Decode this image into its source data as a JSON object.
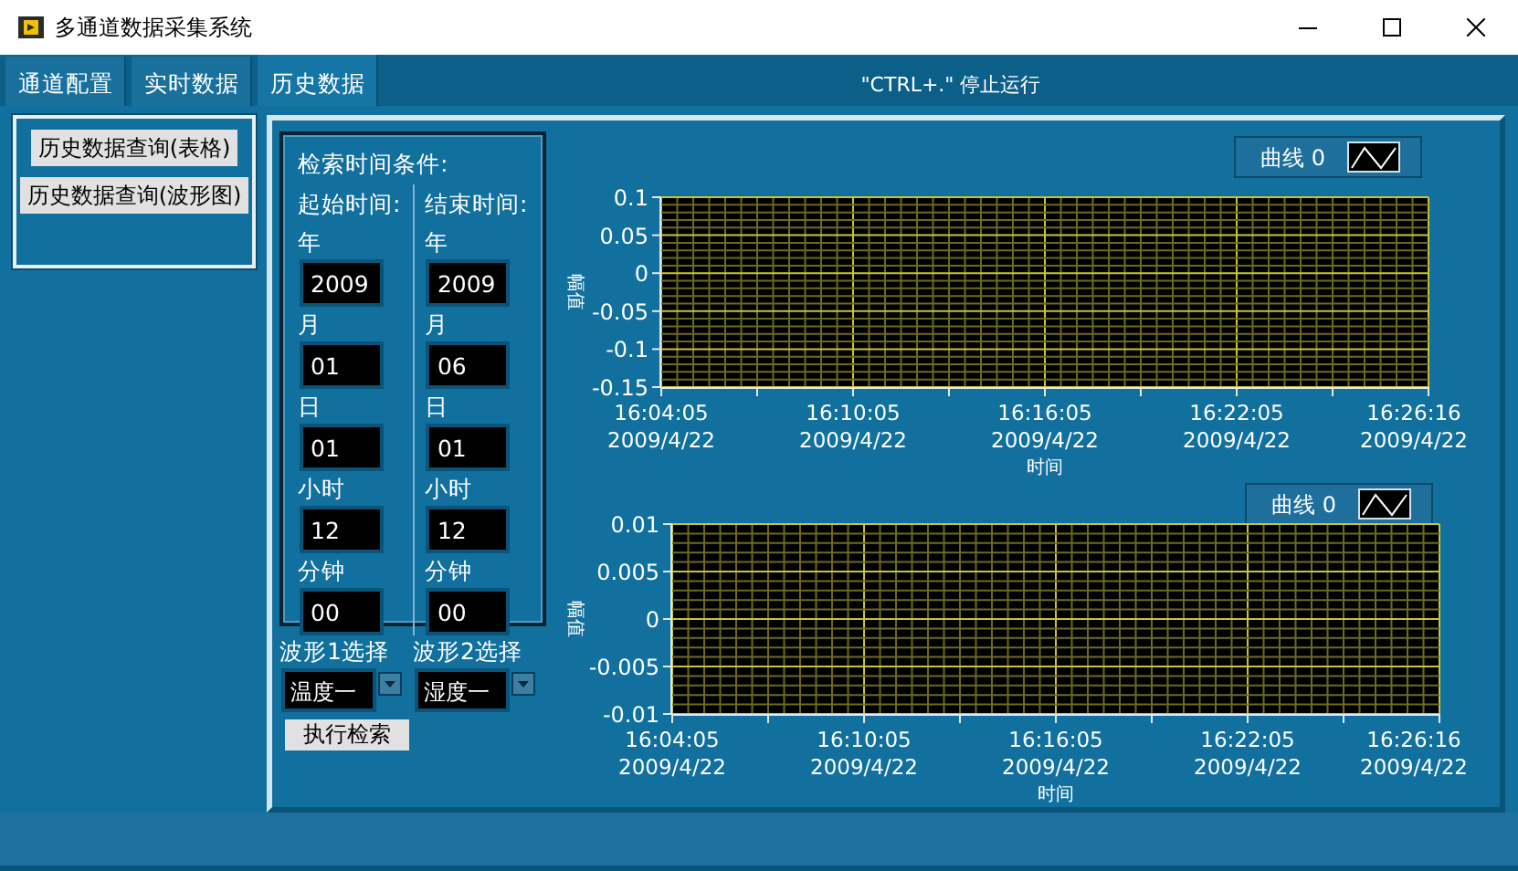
{
  "window": {
    "title": "多通道数据采集系统"
  },
  "tabs": [
    {
      "label": "通道配置",
      "selected": false
    },
    {
      "label": "实时数据",
      "selected": false
    },
    {
      "label": "历史数据",
      "selected": true
    }
  ],
  "status_hint": "\"CTRL+.\" 停止运行",
  "query_buttons": [
    "历史数据查询(表格)",
    "历史数据查询(波形图)"
  ],
  "time_conditions": {
    "title": "检索时间条件:",
    "columns": [
      {
        "heading": "起始时间:",
        "fields": [
          {
            "label": "年",
            "value": "2009"
          },
          {
            "label": "月",
            "value": "01"
          },
          {
            "label": "日",
            "value": "01"
          },
          {
            "label": "小时",
            "value": "12"
          },
          {
            "label": "分钟",
            "value": "00"
          }
        ]
      },
      {
        "heading": "结束时间:",
        "fields": [
          {
            "label": "年",
            "value": "2009"
          },
          {
            "label": "月",
            "value": "06"
          },
          {
            "label": "日",
            "value": "01"
          },
          {
            "label": "小时",
            "value": "12"
          },
          {
            "label": "分钟",
            "value": "00"
          }
        ]
      }
    ]
  },
  "waveform_selectors": [
    {
      "label": "波形1选择",
      "value": "温度一"
    },
    {
      "label": "波形2选择",
      "value": "湿度一"
    }
  ],
  "search_button": "执行检索",
  "charts": [
    {
      "chart_data": {
        "type": "line",
        "xlabel": "时间",
        "ylabel": "幅值",
        "ylim": [
          -0.15,
          0.1
        ],
        "yticks": [
          0.1,
          0.05,
          0,
          -0.05,
          -0.1,
          -0.15
        ],
        "categories": [
          "16:04:05 2009/4/22",
          "16:10:05 2009/4/22",
          "16:16:05 2009/4/22",
          "16:22:05 2009/4/22",
          "16:26:16 2009/4/22"
        ],
        "grid": true,
        "series": [
          {
            "name": "曲线 0",
            "color": "#ffffff",
            "values": [
              null,
              null,
              null,
              null,
              null
            ]
          }
        ]
      }
    },
    {
      "chart_data": {
        "type": "line",
        "xlabel": "时间",
        "ylabel": "幅值",
        "ylim": [
          -0.01,
          0.01
        ],
        "yticks": [
          0.01,
          0.005,
          0,
          -0.005,
          -0.01
        ],
        "categories": [
          "16:04:05 2009/4/22",
          "16:10:05 2009/4/22",
          "16:16:05 2009/4/22",
          "16:22:05 2009/4/22",
          "16:26:16 2009/4/22"
        ],
        "grid": true,
        "series": [
          {
            "name": "曲线 0",
            "color": "#ffffff",
            "values": [
              null,
              null,
              null,
              null,
              null
            ]
          }
        ]
      }
    }
  ]
}
